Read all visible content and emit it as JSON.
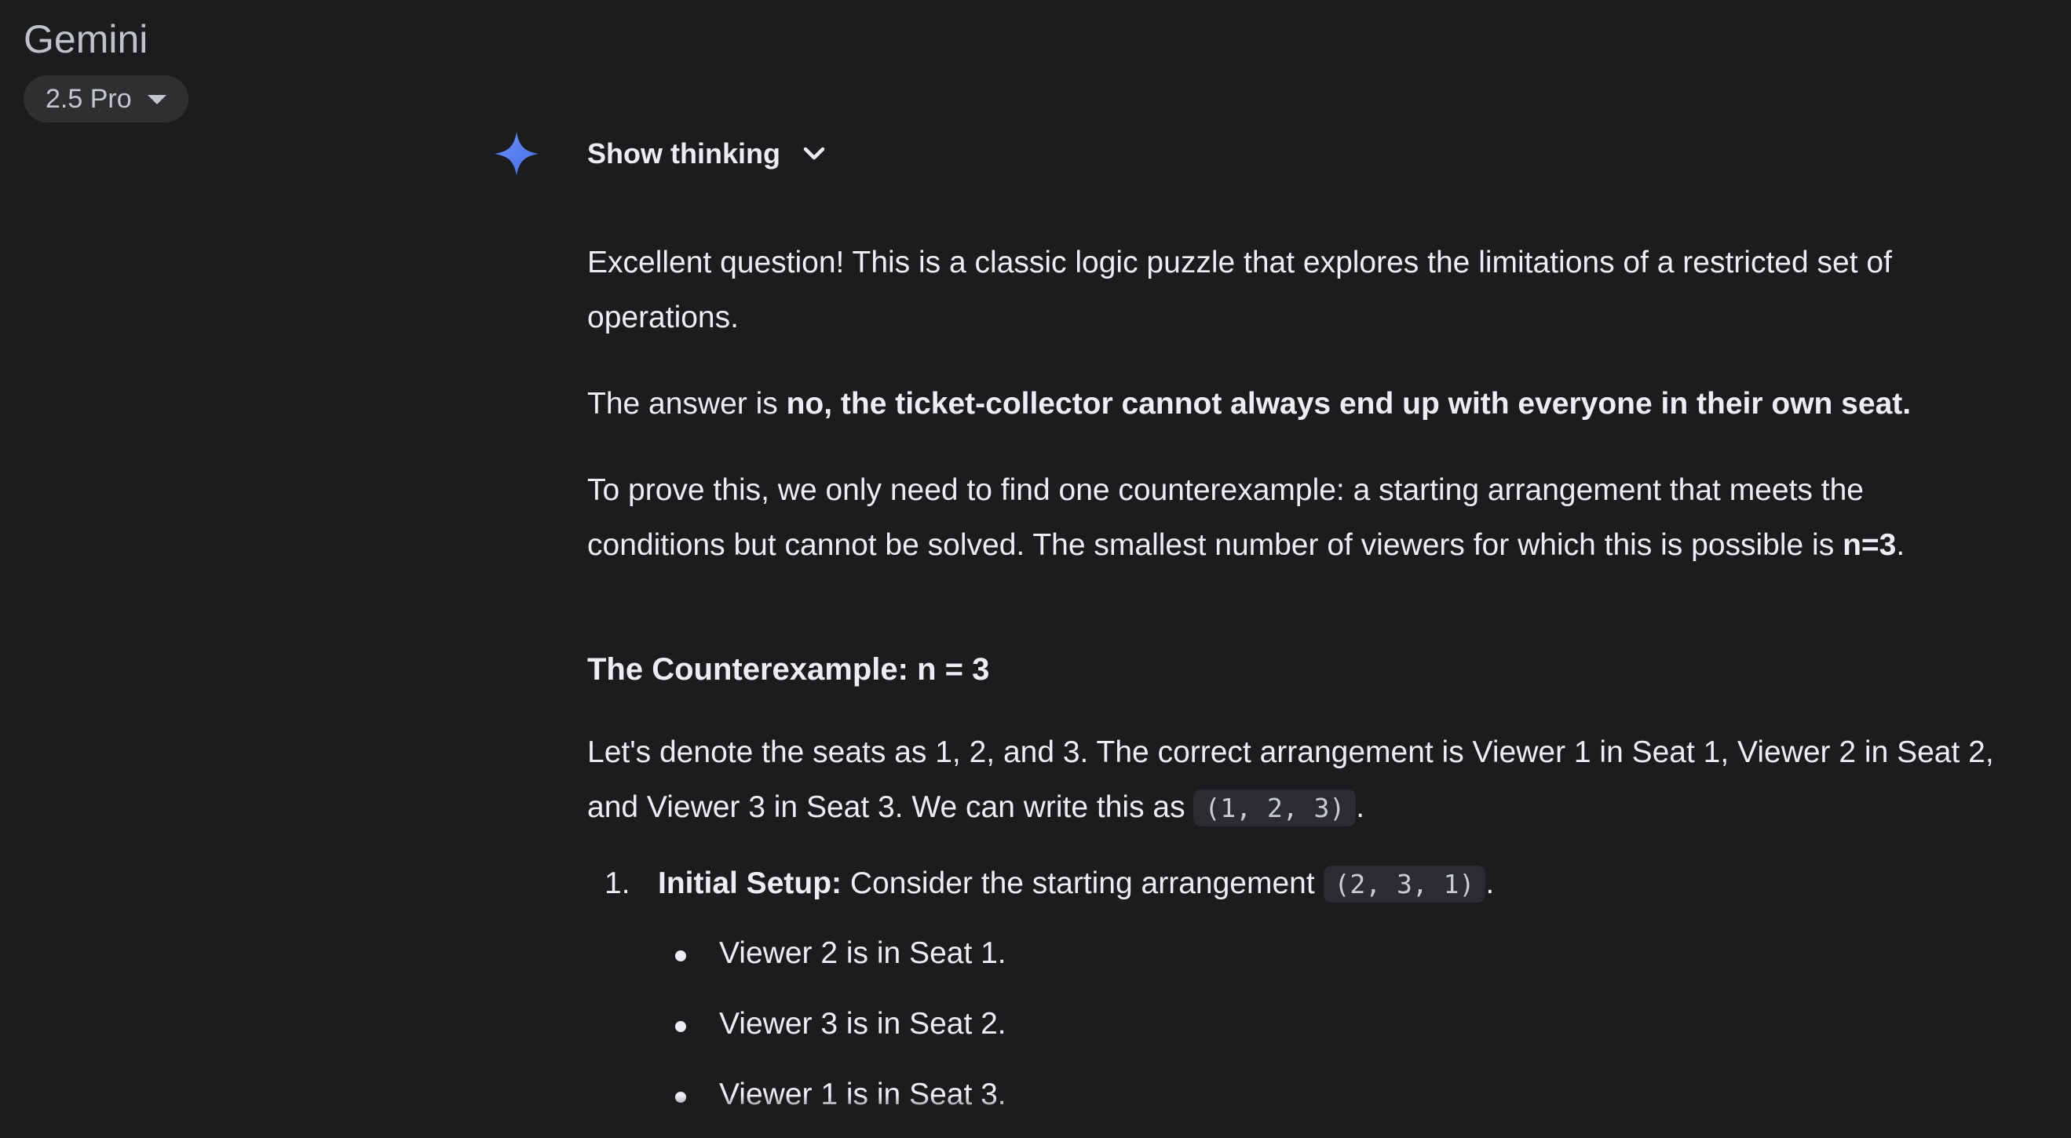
{
  "app": {
    "title": "Gemini",
    "model_label": "2.5 Pro"
  },
  "thinking": {
    "label": "Show thinking"
  },
  "response": {
    "p1": "Excellent question! This is a classic logic puzzle that explores the limitations of a restricted set of operations.",
    "p2_prefix": "The answer is ",
    "p2_bold": "no, the ticket-collector cannot always end up with everyone in their own seat.",
    "p3_text": "To prove this, we only need to find one counterexample: a starting arrangement that meets the conditions but cannot be solved. The smallest number of viewers for which this is possible is ",
    "p3_bold": "n=3",
    "p3_end": ".",
    "heading": "The Counterexample: n = 3",
    "p4_text": "Let's denote the seats as 1, 2, and 3. The correct arrangement is Viewer 1 in Seat 1, Viewer 2 in Seat 2, and Viewer 3 in Seat 3. We can write this as ",
    "p4_code": "(1, 2, 3)",
    "p4_end": ".",
    "steps": [
      {
        "number": "1.",
        "title": "Initial Setup:",
        "text": " Consider the starting arrangement ",
        "code": "(2, 3, 1)",
        "end": ".",
        "bullets": [
          "Viewer 2 is in Seat 1.",
          "Viewer 3 is in Seat 2.",
          "Viewer 1 is in Seat 3."
        ]
      }
    ]
  },
  "colors": {
    "background": "#1b1c1e",
    "text": "#eceef1",
    "chip_bg": "#2d2f31",
    "code_bg": "#2a2c2f",
    "spark_blue": "#4f7ef0"
  }
}
